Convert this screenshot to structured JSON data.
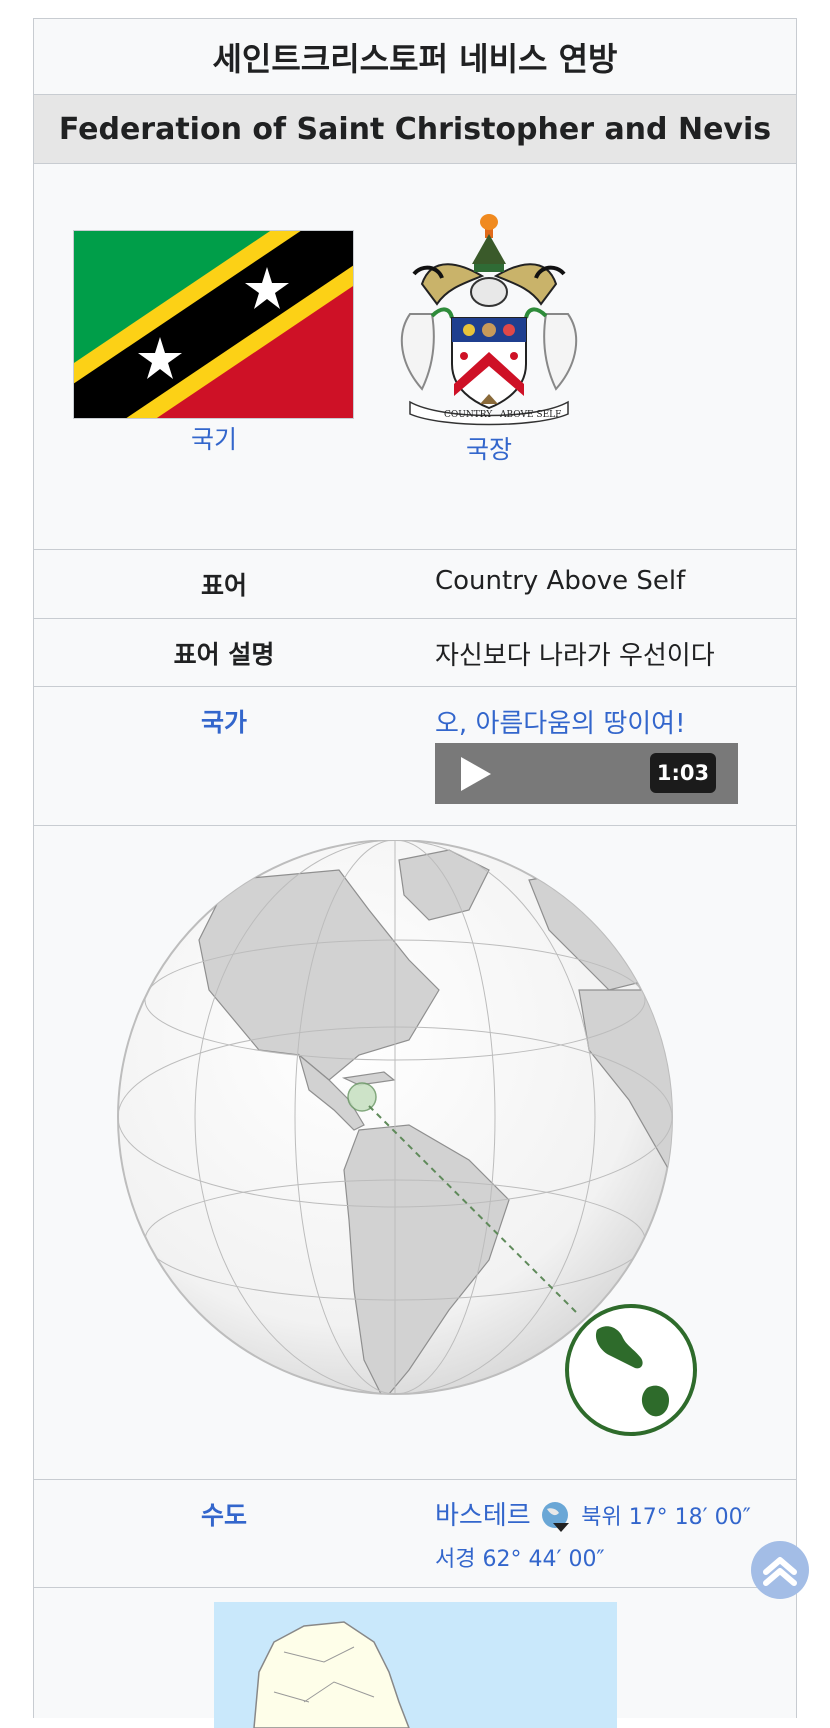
{
  "infobox": {
    "title": "세인트크리스토퍼 네비스 연방",
    "subtitle": "Federation of Saint Christopher and Nevis",
    "flag_caption": "국기",
    "coat_caption": "국장",
    "coat_ribbon_left": "COUNTRY",
    "coat_ribbon_right": "ABOVE SELF",
    "motto_label": "표어",
    "motto_value": "Country Above Self",
    "motto_desc_label": "표어 설명",
    "motto_desc_value": "자신보다 나라가 우선이다",
    "anthem_label": "국가",
    "anthem_value": "오, 아름다움의 땅이여!",
    "anthem_duration": "1:03",
    "capital_label": "수도",
    "capital_value": "바스테르",
    "capital_coord_1": "북위 17° 18′ 00″",
    "capital_coord_2": "서경 62° 44′ 00″"
  },
  "colors": {
    "flag_green": "#009e49",
    "flag_red": "#ce1126",
    "flag_yellow": "#fcd116",
    "flag_black": "#000000",
    "link": "#3366cc",
    "nevis_green": "#2e6b2b",
    "map_sea": "#c9e8fb",
    "map_land": "#fefee9"
  },
  "icons": {
    "play": "play-icon",
    "globe": "globe-icon",
    "scroll_top": "chevron-up-icon"
  }
}
